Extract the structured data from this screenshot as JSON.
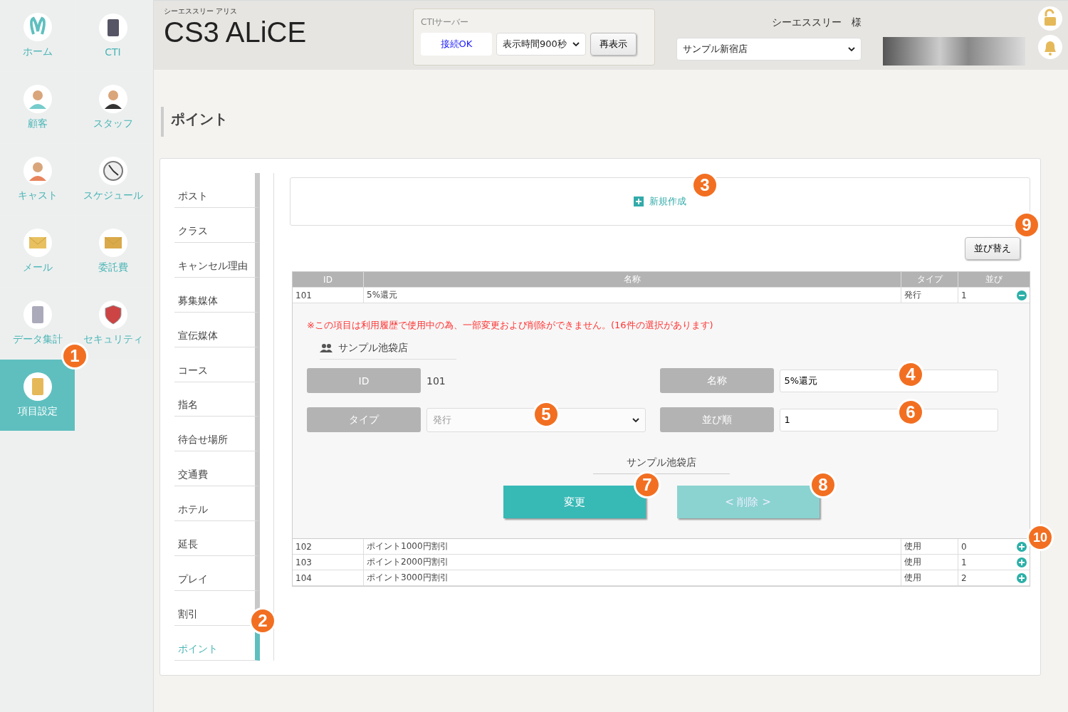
{
  "sidebar": {
    "items": [
      {
        "label": "ホーム",
        "selected": false
      },
      {
        "label": "CTI",
        "selected": false
      },
      {
        "label": "顧客",
        "selected": false
      },
      {
        "label": "スタッフ",
        "selected": false
      },
      {
        "label": "キャスト",
        "selected": false
      },
      {
        "label": "スケジュール",
        "selected": false
      },
      {
        "label": "メール",
        "selected": false
      },
      {
        "label": "委託費",
        "selected": false
      },
      {
        "label": "データ集計",
        "selected": false
      },
      {
        "label": "セキュリティ",
        "selected": false
      },
      {
        "label": "項目設定",
        "selected": true
      }
    ]
  },
  "header": {
    "subtitle": "シーエススリー アリス",
    "title": "CS3 ALiCE",
    "cti": {
      "label": "CTIサーバー",
      "status": "接続OK",
      "interval": "表示時間900秒",
      "refresh": "再表示"
    },
    "user": "シーエススリー　様",
    "store": "サンプル新宿店"
  },
  "page_title": "ポイント",
  "submenu": [
    {
      "label": "ポスト",
      "selected": false
    },
    {
      "label": "クラス",
      "selected": false
    },
    {
      "label": "キャンセル理由",
      "selected": false
    },
    {
      "label": "募集媒体",
      "selected": false
    },
    {
      "label": "宣伝媒体",
      "selected": false
    },
    {
      "label": "コース",
      "selected": false
    },
    {
      "label": "指名",
      "selected": false
    },
    {
      "label": "待合せ場所",
      "selected": false
    },
    {
      "label": "交通費",
      "selected": false
    },
    {
      "label": "ホテル",
      "selected": false
    },
    {
      "label": "延長",
      "selected": false
    },
    {
      "label": "プレイ",
      "selected": false
    },
    {
      "label": "割引",
      "selected": false
    },
    {
      "label": "ポイント",
      "selected": true
    }
  ],
  "new_button": "新規作成",
  "sort_button": "並び替え",
  "table": {
    "columns": [
      "ID",
      "名称",
      "タイプ",
      "並び"
    ],
    "rows": [
      {
        "cells": [
          "101",
          "5%還元",
          "発行",
          "1"
        ],
        "expanded": true
      },
      {
        "cells": [
          "102",
          "ポイント1000円割引",
          "使用",
          "0"
        ],
        "expanded": false
      },
      {
        "cells": [
          "103",
          "ポイント2000円割引",
          "使用",
          "1"
        ],
        "expanded": false
      },
      {
        "cells": [
          "104",
          "ポイント3000円割引",
          "使用",
          "2"
        ],
        "expanded": false
      }
    ]
  },
  "detail": {
    "warning": "※この項目は利用履歴で使用中の為、一部変更および削除ができません。(16件の選択があります)",
    "store": "サンプル池袋店",
    "fields": [
      {
        "label": "ID",
        "kind": "text",
        "value": "101"
      },
      {
        "label": "名称",
        "kind": "input",
        "value": "5%還元"
      },
      {
        "label": "タイプ",
        "kind": "select",
        "value": "発行",
        "disabled": true
      },
      {
        "label": "並び順",
        "kind": "input",
        "value": "1"
      }
    ],
    "store_footer": "サンプル池袋店",
    "buttons": [
      {
        "label": "変更",
        "disabled": false
      },
      {
        "label": "< 削除 >",
        "disabled": true
      }
    ]
  },
  "callouts": [
    "1",
    "2",
    "3",
    "4",
    "5",
    "6",
    "7",
    "8",
    "9",
    "10"
  ]
}
